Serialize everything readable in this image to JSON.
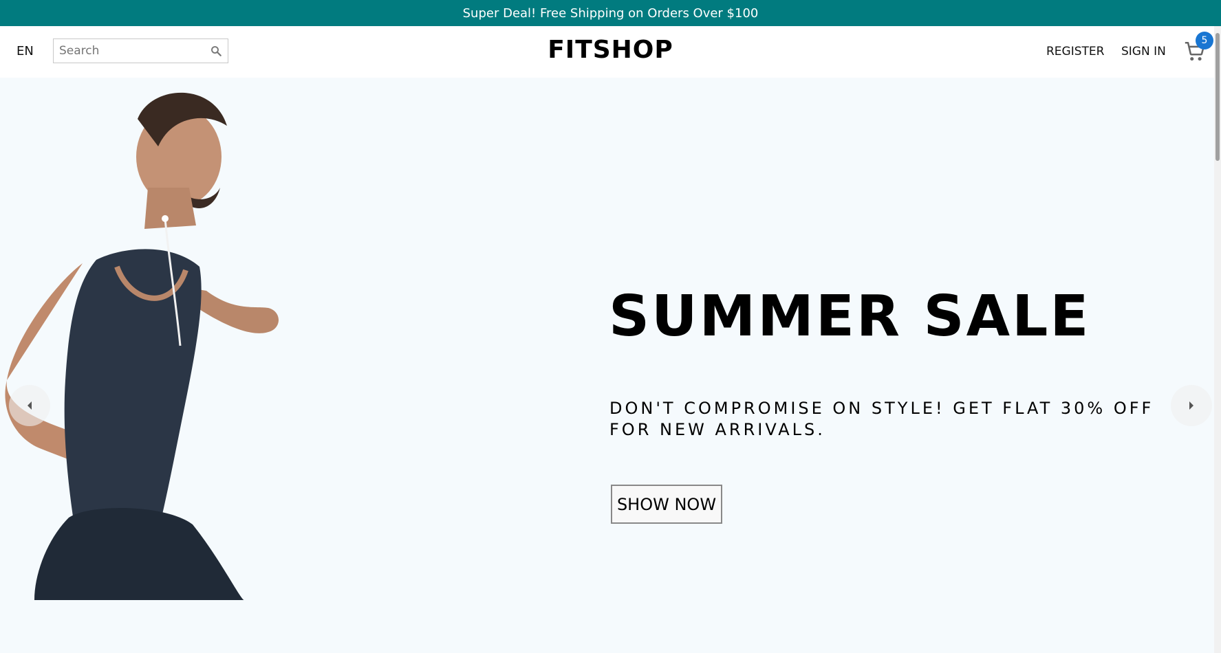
{
  "announcement": {
    "text": "Super Deal! Free Shipping on Orders Over $100"
  },
  "header": {
    "language": "EN",
    "search": {
      "placeholder": "Search",
      "value": ""
    },
    "logo": "FITSHOP",
    "register_label": "REGISTER",
    "signin_label": "SIGN IN",
    "cart_count": "5"
  },
  "hero": {
    "title": "SUMMER SALE",
    "description": "DON'T COMPROMISE ON STYLE! GET FLAT 30% OFF FOR NEW ARRIVALS.",
    "button_label": "SHOW NOW"
  },
  "colors": {
    "announcement_bg": "#017b7f",
    "hero_bg": "#f5fafd",
    "cart_badge": "#1976d2"
  },
  "icons": [
    "search-icon",
    "cart-icon",
    "chevron-left-icon",
    "chevron-right-icon"
  ]
}
